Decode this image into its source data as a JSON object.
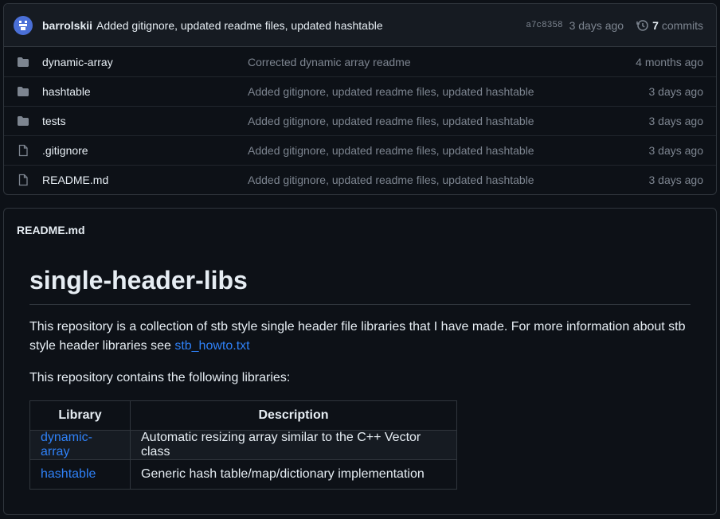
{
  "commit": {
    "author": "barrolskii",
    "message": "Added gitignore, updated readme files, updated hashtable",
    "sha": "a7c8358",
    "age": "3 days ago",
    "commits_count": "7",
    "commits_label": "commits"
  },
  "files": [
    {
      "name": "dynamic-array",
      "type": "folder",
      "message": "Corrected dynamic array readme",
      "age": "4 months ago"
    },
    {
      "name": "hashtable",
      "type": "folder",
      "message": "Added gitignore, updated readme files, updated hashtable",
      "age": "3 days ago"
    },
    {
      "name": "tests",
      "type": "folder",
      "message": "Added gitignore, updated readme files, updated hashtable",
      "age": "3 days ago"
    },
    {
      "name": ".gitignore",
      "type": "file",
      "message": "Added gitignore, updated readme files, updated hashtable",
      "age": "3 days ago"
    },
    {
      "name": "README.md",
      "type": "file",
      "message": "Added gitignore, updated readme files, updated hashtable",
      "age": "3 days ago"
    }
  ],
  "readme": {
    "header": "README.md",
    "title": "single-header-libs",
    "intro": "This repository is a collection of stb style single header file libraries that I have made. For more information about stb style header libraries see ",
    "intro_link": "stb_howto.txt",
    "contains": "This repository contains the following libraries:",
    "table": {
      "headers": [
        "Library",
        "Description"
      ],
      "rows": [
        {
          "library": "dynamic-array",
          "description": "Automatic resizing array similar to the C++ Vector class"
        },
        {
          "library": "hashtable",
          "description": "Generic hash table/map/dictionary implementation"
        }
      ]
    }
  },
  "colors": {
    "background": "#0d1117",
    "link": "#2f81f7",
    "muted": "#7d8590",
    "border": "#30363d"
  }
}
